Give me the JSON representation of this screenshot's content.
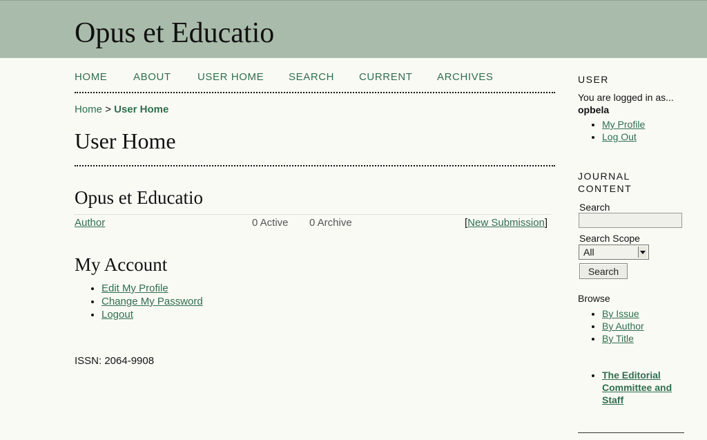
{
  "site": {
    "title": "Opus et Educatio"
  },
  "nav": [
    "HOME",
    "ABOUT",
    "USER HOME",
    "SEARCH",
    "CURRENT",
    "ARCHIVES"
  ],
  "breadcrumb": {
    "home": "Home",
    "separator": ">",
    "current": "User Home"
  },
  "page": {
    "title": "User Home"
  },
  "journal": {
    "name": "Opus et Educatio",
    "role": "Author",
    "active": "0 Active",
    "archive": "0 Archive",
    "bracket_open": "[",
    "new_submission": "New Submission",
    "bracket_close": "]"
  },
  "account": {
    "heading": "My Account",
    "links": [
      "Edit My Profile",
      "Change My Password",
      "Logout"
    ]
  },
  "footer": {
    "issn": "ISSN: 2064-9908"
  },
  "sidebar": {
    "user_heading": "USER",
    "logged_in_text": "You are logged in as...",
    "username": "opbela",
    "user_links": [
      "My Profile",
      "Log Out"
    ],
    "journal_heading_1": "JOURNAL",
    "journal_heading_2": "CONTENT",
    "search_label": "Search",
    "search_value": "",
    "scope_label": "Search Scope",
    "scope_value": "All",
    "search_button": "Search",
    "browse_label": "Browse",
    "browse_links": [
      "By Issue",
      "By Author",
      "By Title"
    ],
    "editorial_link_lines": [
      "The Editorial",
      "Committee and",
      "Staff"
    ]
  },
  "colors": {
    "header_bg": "#a9bbaa",
    "link": "#2f6e4f",
    "page_bg": "#fafaf4"
  }
}
